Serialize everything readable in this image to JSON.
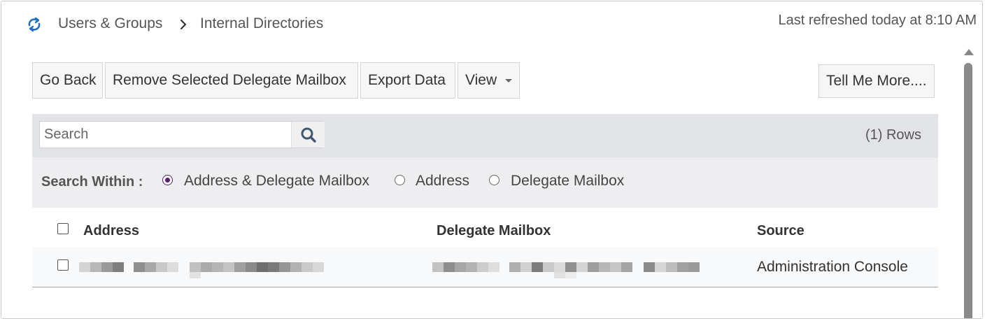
{
  "breadcrumb": {
    "refresh_icon": "refresh-icon",
    "items": [
      "Users & Groups",
      "Internal Directories"
    ]
  },
  "last_refreshed": "Last refreshed today at 8:10 AM",
  "toolbar": {
    "go_back": "Go Back",
    "remove_delegate": "Remove Selected Delegate Mailbox",
    "export_data": "Export Data",
    "view": "View",
    "tell_me_more": "Tell Me More...."
  },
  "search": {
    "placeholder": "Search",
    "value": "",
    "rows_count": "(1) Rows"
  },
  "search_within": {
    "label": "Search Within :",
    "options": [
      {
        "label": "Address & Delegate Mailbox",
        "selected": true
      },
      {
        "label": "Address",
        "selected": false
      },
      {
        "label": "Delegate Mailbox",
        "selected": false
      }
    ]
  },
  "table": {
    "columns": [
      "Address",
      "Delegate Mailbox",
      "Source"
    ],
    "rows": [
      {
        "address": "[redacted]",
        "delegate_mailbox": "[redacted]",
        "source": "Administration Console",
        "checked": false
      }
    ]
  },
  "colors": {
    "accent_icon": "#1e6fc8",
    "radio_selected": "#5a1f6e",
    "search_panel_bg": "#e1e3e7",
    "within_panel_bg": "#eeeef0"
  }
}
